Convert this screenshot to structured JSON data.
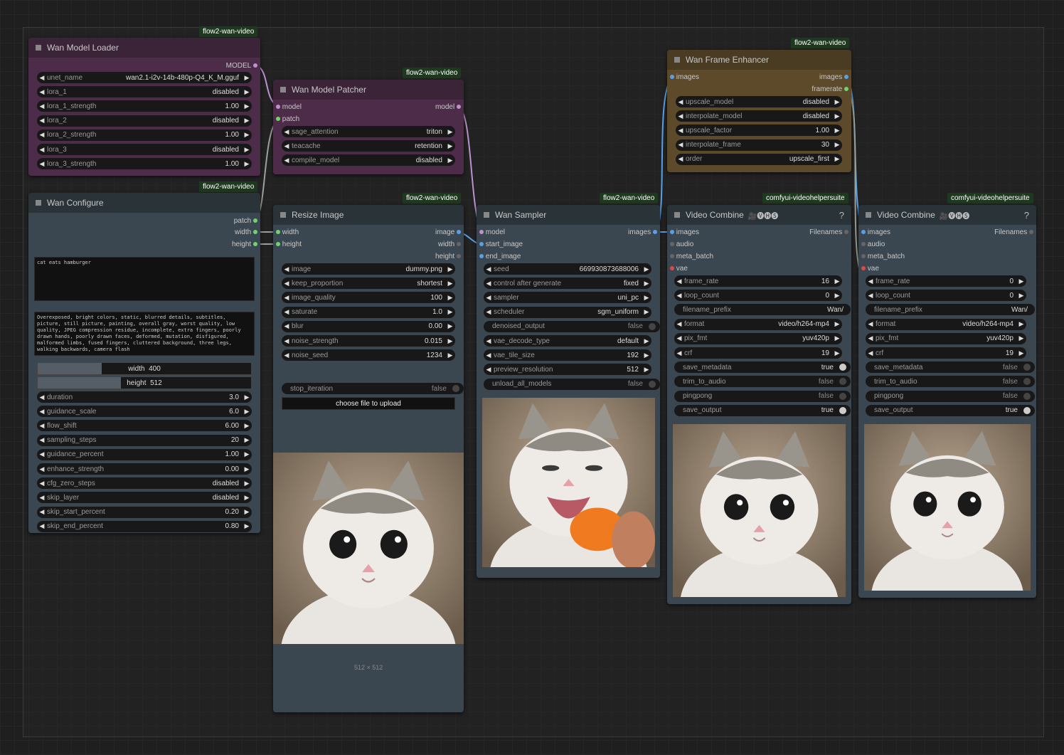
{
  "colors": {
    "purple_body": "#4d2c4a",
    "slate_body": "#3a4750",
    "brown_body": "#5c4a2a",
    "wire_blue": "#5aa0e8",
    "wire_gray": "#9aa39a",
    "wire_purple": "#c08fd0",
    "dot_green": "#6fd36f",
    "dot_red": "#e04848",
    "dot_purple": "#c08fd0",
    "dot_blue": "#5aa0e8"
  },
  "badges": {
    "flow2": "flow2-wan-video",
    "vhs": "comfyui-videohelpersuite"
  },
  "loader": {
    "title": "Wan Model Loader",
    "output": "MODEL",
    "widgets": [
      {
        "label": "unet_name",
        "value": "wan2.1-i2v-14b-480p-Q4_K_M.gguf"
      },
      {
        "label": "lora_1",
        "value": "disabled"
      },
      {
        "label": "lora_1_strength",
        "value": "1.00"
      },
      {
        "label": "lora_2",
        "value": "disabled"
      },
      {
        "label": "lora_2_strength",
        "value": "1.00"
      },
      {
        "label": "lora_3",
        "value": "disabled"
      },
      {
        "label": "lora_3_strength",
        "value": "1.00"
      }
    ]
  },
  "patcher": {
    "title": "Wan Model Patcher",
    "inputs": [
      "model",
      "patch"
    ],
    "output": "model",
    "widgets": [
      {
        "label": "sage_attention",
        "value": "triton"
      },
      {
        "label": "teacache",
        "value": "retention"
      },
      {
        "label": "compile_model",
        "value": "disabled"
      }
    ]
  },
  "configure": {
    "title": "Wan Configure",
    "outputs": [
      "patch",
      "width",
      "height"
    ],
    "prompt": "cat eats hamburger",
    "negative": "Overexposed, bright colors, static, blurred details, subtitles, picture, still picture, painting, overall gray, worst quality, low quality, JPEG compression residue, incomplete, extra fingers, poorly drawn hands, poorly drawn faces, deformed, mutation, disfigured, malformed limbs, fused fingers, cluttered background, three legs, walking backwards, camera flash",
    "width_label": "width",
    "width_value": "400",
    "height_label": "height",
    "height_value": "512",
    "widgets": [
      {
        "label": "duration",
        "value": "3.0"
      },
      {
        "label": "guidance_scale",
        "value": "6.0"
      },
      {
        "label": "flow_shift",
        "value": "6.00"
      },
      {
        "label": "sampling_steps",
        "value": "20"
      },
      {
        "label": "guidance_percent",
        "value": "1.00"
      },
      {
        "label": "enhance_strength",
        "value": "0.00"
      },
      {
        "label": "cfg_zero_steps",
        "value": "disabled"
      },
      {
        "label": "skip_layer",
        "value": "disabled"
      },
      {
        "label": "skip_start_percent",
        "value": "0.20"
      },
      {
        "label": "skip_end_percent",
        "value": "0.80"
      }
    ]
  },
  "resize": {
    "title": "Resize Image",
    "inputs": [
      "width",
      "height"
    ],
    "outputs": [
      "image",
      "width",
      "height"
    ],
    "widgets": [
      {
        "label": "image",
        "value": "dummy.png"
      },
      {
        "label": "keep_proportion",
        "value": "shortest"
      },
      {
        "label": "image_quality",
        "value": "100"
      },
      {
        "label": "saturate",
        "value": "1.0"
      },
      {
        "label": "blur",
        "value": "0.00"
      },
      {
        "label": "noise_strength",
        "value": "0.015"
      },
      {
        "label": "noise_seed",
        "value": "1234"
      }
    ],
    "stop_label": "stop_iteration",
    "stop_value": "false",
    "upload_label": "choose file to upload",
    "caption": "512 × 512"
  },
  "sampler": {
    "title": "Wan Sampler",
    "inputs": [
      "model",
      "start_image",
      "end_image"
    ],
    "output": "images",
    "widgets": [
      {
        "label": "seed",
        "value": "669930873688006",
        "type": "combo"
      },
      {
        "label": "control after generate",
        "value": "fixed",
        "type": "combo"
      },
      {
        "label": "sampler",
        "value": "uni_pc",
        "type": "combo"
      },
      {
        "label": "scheduler",
        "value": "sgm_uniform",
        "type": "combo"
      },
      {
        "label": "denoised_output",
        "value": "false",
        "type": "toggle",
        "on": false
      },
      {
        "label": "vae_decode_type",
        "value": "default",
        "type": "combo"
      },
      {
        "label": "vae_tile_size",
        "value": "192",
        "type": "combo"
      },
      {
        "label": "preview_resolution",
        "value": "512",
        "type": "combo"
      },
      {
        "label": "unload_all_models",
        "value": "false",
        "type": "toggle",
        "on": false
      }
    ]
  },
  "enhancer": {
    "title": "Wan Frame Enhancer",
    "input": "images",
    "outputs": [
      "images",
      "framerate"
    ],
    "widgets": [
      {
        "label": "upscale_model",
        "value": "disabled"
      },
      {
        "label": "interpolate_model",
        "value": "disabled"
      },
      {
        "label": "upscale_factor",
        "value": "1.00"
      },
      {
        "label": "interpolate_frame",
        "value": "30"
      },
      {
        "label": "order",
        "value": "upscale_first"
      }
    ]
  },
  "combine1": {
    "title": "Video Combine",
    "emoji": "🎥🅥🅗🅢",
    "help": "?",
    "inputs": [
      "images",
      "audio",
      "meta_batch",
      "vae"
    ],
    "output": "Filenames",
    "widgets": [
      {
        "label": "frame_rate",
        "value": "16",
        "type": "combo"
      },
      {
        "label": "loop_count",
        "value": "0",
        "type": "combo"
      },
      {
        "label": "filename_prefix",
        "value": "Wan/",
        "type": "text"
      },
      {
        "label": "format",
        "value": "video/h264-mp4",
        "type": "combo"
      },
      {
        "label": "pix_fmt",
        "value": "yuv420p",
        "type": "combo"
      },
      {
        "label": "crf",
        "value": "19",
        "type": "combo"
      },
      {
        "label": "save_metadata",
        "value": "true",
        "type": "toggle",
        "on": true
      },
      {
        "label": "trim_to_audio",
        "value": "false",
        "type": "toggle",
        "on": false
      },
      {
        "label": "pingpong",
        "value": "false",
        "type": "toggle",
        "on": false
      },
      {
        "label": "save_output",
        "value": "true",
        "type": "toggle",
        "on": true
      }
    ]
  },
  "combine2": {
    "title": "Video Combine",
    "emoji": "🎥🅥🅗🅢",
    "help": "?",
    "inputs": [
      "images",
      "audio",
      "meta_batch",
      "vae"
    ],
    "output": "Filenames",
    "widgets": [
      {
        "label": "frame_rate",
        "value": "0",
        "type": "combo"
      },
      {
        "label": "loop_count",
        "value": "0",
        "type": "combo"
      },
      {
        "label": "filename_prefix",
        "value": "Wan/",
        "type": "text"
      },
      {
        "label": "format",
        "value": "video/h264-mp4",
        "type": "combo"
      },
      {
        "label": "pix_fmt",
        "value": "yuv420p",
        "type": "combo"
      },
      {
        "label": "crf",
        "value": "19",
        "type": "combo"
      },
      {
        "label": "save_metadata",
        "value": "false",
        "type": "toggle",
        "on": false
      },
      {
        "label": "trim_to_audio",
        "value": "false",
        "type": "toggle",
        "on": false
      },
      {
        "label": "pingpong",
        "value": "false",
        "type": "toggle",
        "on": false
      },
      {
        "label": "save_output",
        "value": "true",
        "type": "toggle",
        "on": true
      }
    ]
  }
}
